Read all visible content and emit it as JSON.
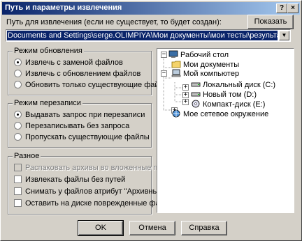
{
  "window": {
    "title": "Путь и параметры извлечения",
    "help_btn": "?",
    "close_btn": "×"
  },
  "path": {
    "label": "Путь для извлечения (если не существует, то будет создан):",
    "value": "Documents and Settings\\serge.OLIMPIYA\\Мои документы\\мои тесты\\результаты\\результаты",
    "show_button": "Показать"
  },
  "update_mode": {
    "title": "Режим обновления",
    "options": [
      "Извлечь с заменой файлов",
      "Извлечь с обновлением файлов",
      "Обновить только существующие файлы"
    ],
    "selected": 0
  },
  "overwrite_mode": {
    "title": "Режим перезаписи",
    "options": [
      "Выдавать запрос при перезаписи",
      "Перезаписывать без запроса",
      "Пропускать существующие файлы"
    ],
    "selected": 0
  },
  "misc": {
    "title": "Разное",
    "options": [
      {
        "label": "Распаковать архивы во вложенные папки",
        "disabled": true
      },
      {
        "label": "Извлекать файлы без путей",
        "disabled": false
      },
      {
        "label": "Снимать у файлов атрибут \"Архивный\"",
        "disabled": false
      },
      {
        "label": "Оставить на диске поврежденные файлы",
        "disabled": false
      }
    ]
  },
  "tree": {
    "items": [
      {
        "label": "Рабочий стол",
        "icon": "desktop-icon"
      },
      {
        "label": "Мои документы",
        "icon": "folder-icon"
      },
      {
        "label": "Мой компьютер",
        "icon": "computer-icon"
      },
      {
        "label": "Локальный диск (C:)",
        "icon": "drive-icon"
      },
      {
        "label": "Новый том (D:)",
        "icon": "drive-icon"
      },
      {
        "label": "Компакт-диск (E:)",
        "icon": "cdrom-icon"
      },
      {
        "label": "Мое сетевое окружение",
        "icon": "network-icon"
      }
    ]
  },
  "buttons": {
    "ok": "OK",
    "cancel": "Отмена",
    "help": "Справка"
  },
  "colors": {
    "titlebar": "#0a246a",
    "face": "#d4d0c8",
    "selection": "#0a246a"
  }
}
